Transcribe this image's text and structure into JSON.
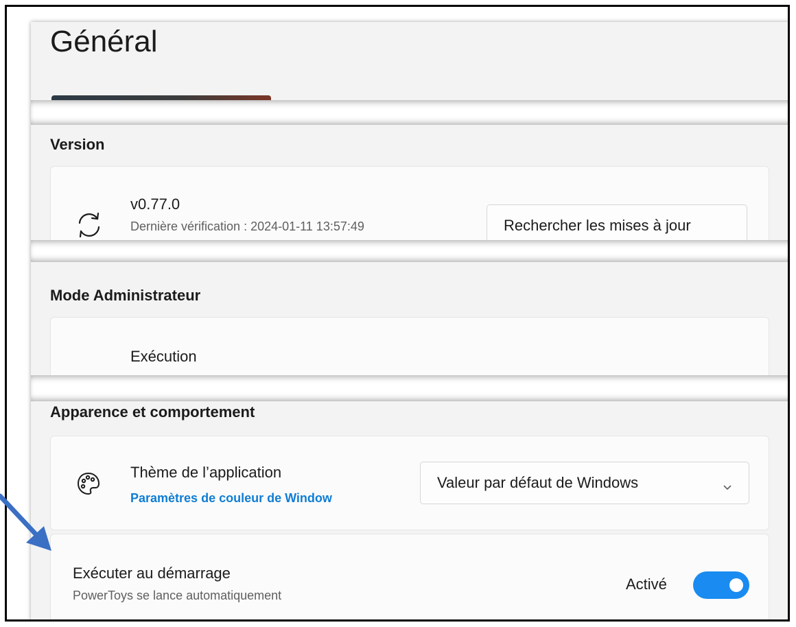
{
  "page": {
    "title": "Général"
  },
  "version": {
    "section_title": "Version",
    "version_number": "v0.77.0",
    "last_check": "Dernière vérification :  2024-01-11 13:57:49",
    "check_updates_label": "Rechercher les mises à jour",
    "icon": "sync-icon"
  },
  "admin": {
    "section_title": "Mode Administrateur",
    "execution_label": "Exécution"
  },
  "appearance": {
    "section_title": "Apparence et comportement",
    "theme_label": "Thème de l’application",
    "theme_link": "Paramètres de couleur de Window",
    "theme_value": "Valeur par défaut de Windows",
    "theme_icon": "palette-icon",
    "startup_label": "Exécuter au démarrage",
    "startup_desc": "PowerToys se lance automatiquement",
    "startup_state": "Activé",
    "startup_enabled": true
  },
  "colors": {
    "accent": "#1a8bf0",
    "link": "#0f7dd4",
    "annotation_arrow": "#3a6fc4"
  }
}
